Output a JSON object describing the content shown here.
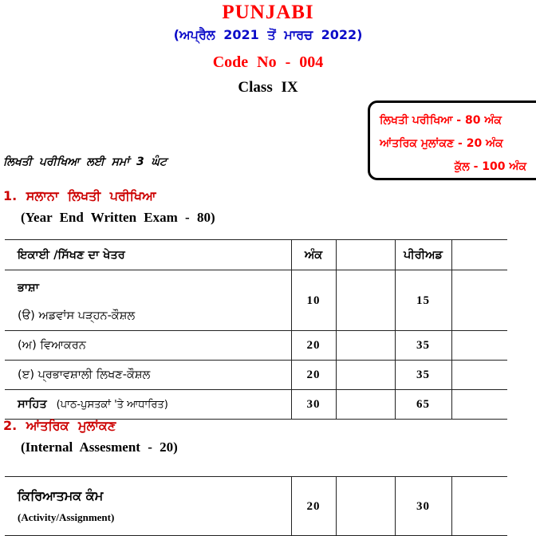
{
  "header": {
    "title": "PUNJABI",
    "period": "(ਅਪ੍ਰੈਲ  2021  ਤੋਂ  ਮਾਰਚ  2022)",
    "code": "Code  No  -  004",
    "class": "Class  IX",
    "title_color": "#ff0000",
    "period_color": "#0b0bc8",
    "code_color": "#ff0000",
    "class_color": "#000000"
  },
  "marks_box": {
    "border_color": "#000000",
    "text_color": "#ff0000",
    "lines": [
      "ਲਿਖਤੀ  ਪਰੀਖਿਆ  -  80  ਅੰਕ",
      "ਆਂਤਰਿਕ  ਮੁਲਾਂਕਣ  -  20  ਅੰਕ",
      "ਕੁੱਲ  -  100  ਅੰਕ"
    ]
  },
  "duration": {
    "text": "ਲਿਖਤੀ  ਪਰੀਖਿਆ  ਲਈ  ਸਮਾਂ  3  ਘੰਟ"
  },
  "sections": {
    "written": {
      "heading_pa": "1.  ਸਲਾਨਾ  ਲਿਖਤੀ  ਪਰੀਖਿਆ",
      "heading_en": "(Year  End  Written  Exam  -  80)",
      "heading_color": "#cc0000",
      "table": {
        "columns": [
          "ਇਕਾਈ /ਸਿੱਖਣ  ਦਾ  ਖੇਤਰ",
          "ਅੰਕ",
          "",
          "ਪੀਰੀਅਡ",
          ""
        ],
        "rows": [
          {
            "topic_primary": "ਭਾਸ਼ਾ",
            "topic_secondary": "(ੳ)  ਅਡਵਾਂਸ  ਪੜ੍ਹਨ-ਕੌਸ਼ਲ",
            "marks": "10",
            "blank1": "",
            "periods": "15",
            "blank2": ""
          },
          {
            "topic": "(ਅ)  ਵਿਆਕਰਨ",
            "marks": "20",
            "blank1": "",
            "periods": "35",
            "blank2": ""
          },
          {
            "topic": "(ੲ)  ਪ੍ਰਭਾਵਸ਼ਾਲੀ  ਲਿਖਣ-ਕੌਸ਼ਲ",
            "marks": "20",
            "blank1": "",
            "periods": "35",
            "blank2": ""
          },
          {
            "topic_bold": "ਸਾਹਿਤ",
            "topic_note": "(ਪਾਠ-ਪੁਸਤਕਾਂ  'ਤੇ  ਆਧਾਰਿਤ)",
            "marks": "30",
            "blank1": "",
            "periods": "65",
            "blank2": ""
          }
        ]
      }
    },
    "internal": {
      "heading_pa": "2.  ਆਂਤਰਿਕ  ਮੁਲਾਂਕਣ",
      "heading_en": "(Internal  Assesment  -  20)",
      "heading_color": "#cc0000",
      "table": {
        "rows": [
          {
            "topic_pa": "ਕਿਰਿਆਤਮਕ  ਕੰਮ",
            "topic_en": "(Activity/Assignment)",
            "marks": "20",
            "blank1": "",
            "periods": "30",
            "blank2": ""
          }
        ]
      }
    }
  }
}
